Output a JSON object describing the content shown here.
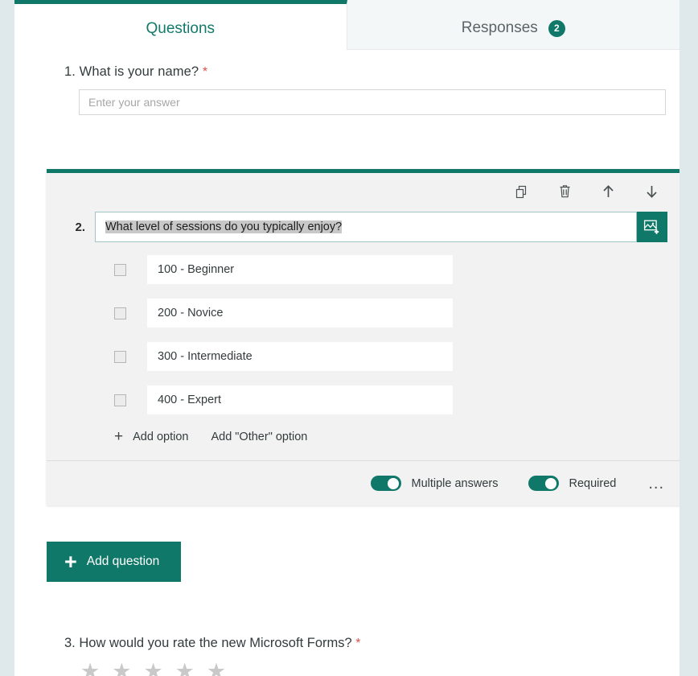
{
  "tabs": [
    {
      "label": "Questions",
      "active": true,
      "badge": null
    },
    {
      "label": "Responses",
      "active": false,
      "badge": "2"
    }
  ],
  "accent_color": "#0f7868",
  "required_marker": "*",
  "question1": {
    "number": "1.",
    "title": "What is your name?",
    "required_marker": "*",
    "answer_placeholder": "Enter your answer"
  },
  "question2": {
    "number": "2.",
    "title_value": "What level of sessions do you typically enjoy?",
    "title_selected": true,
    "toolbar": {
      "copy_label": "Copy question",
      "delete_label": "Delete question",
      "move_up_label": "Move question up",
      "move_down_label": "Move question down"
    },
    "insert_image_label": "Insert image",
    "options": [
      {
        "label": "100 - Beginner",
        "checked": false
      },
      {
        "label": "200 - Novice",
        "checked": false
      },
      {
        "label": "300 - Intermediate",
        "checked": false
      },
      {
        "label": "400 - Expert",
        "checked": false
      }
    ],
    "add_option_label": "Add option",
    "add_other_option_label": "Add \"Other\" option",
    "toggles": [
      {
        "label": "Multiple answers",
        "on": true
      },
      {
        "label": "Required",
        "on": true
      }
    ],
    "more_options_label": "..."
  },
  "add_question": {
    "plus": "+",
    "label": "Add question"
  },
  "question3": {
    "number": "3.",
    "title": "How would you rate the new Microsoft Forms?",
    "required_marker": "*",
    "stars": [
      "★",
      "★",
      "★",
      "★",
      "★"
    ]
  }
}
